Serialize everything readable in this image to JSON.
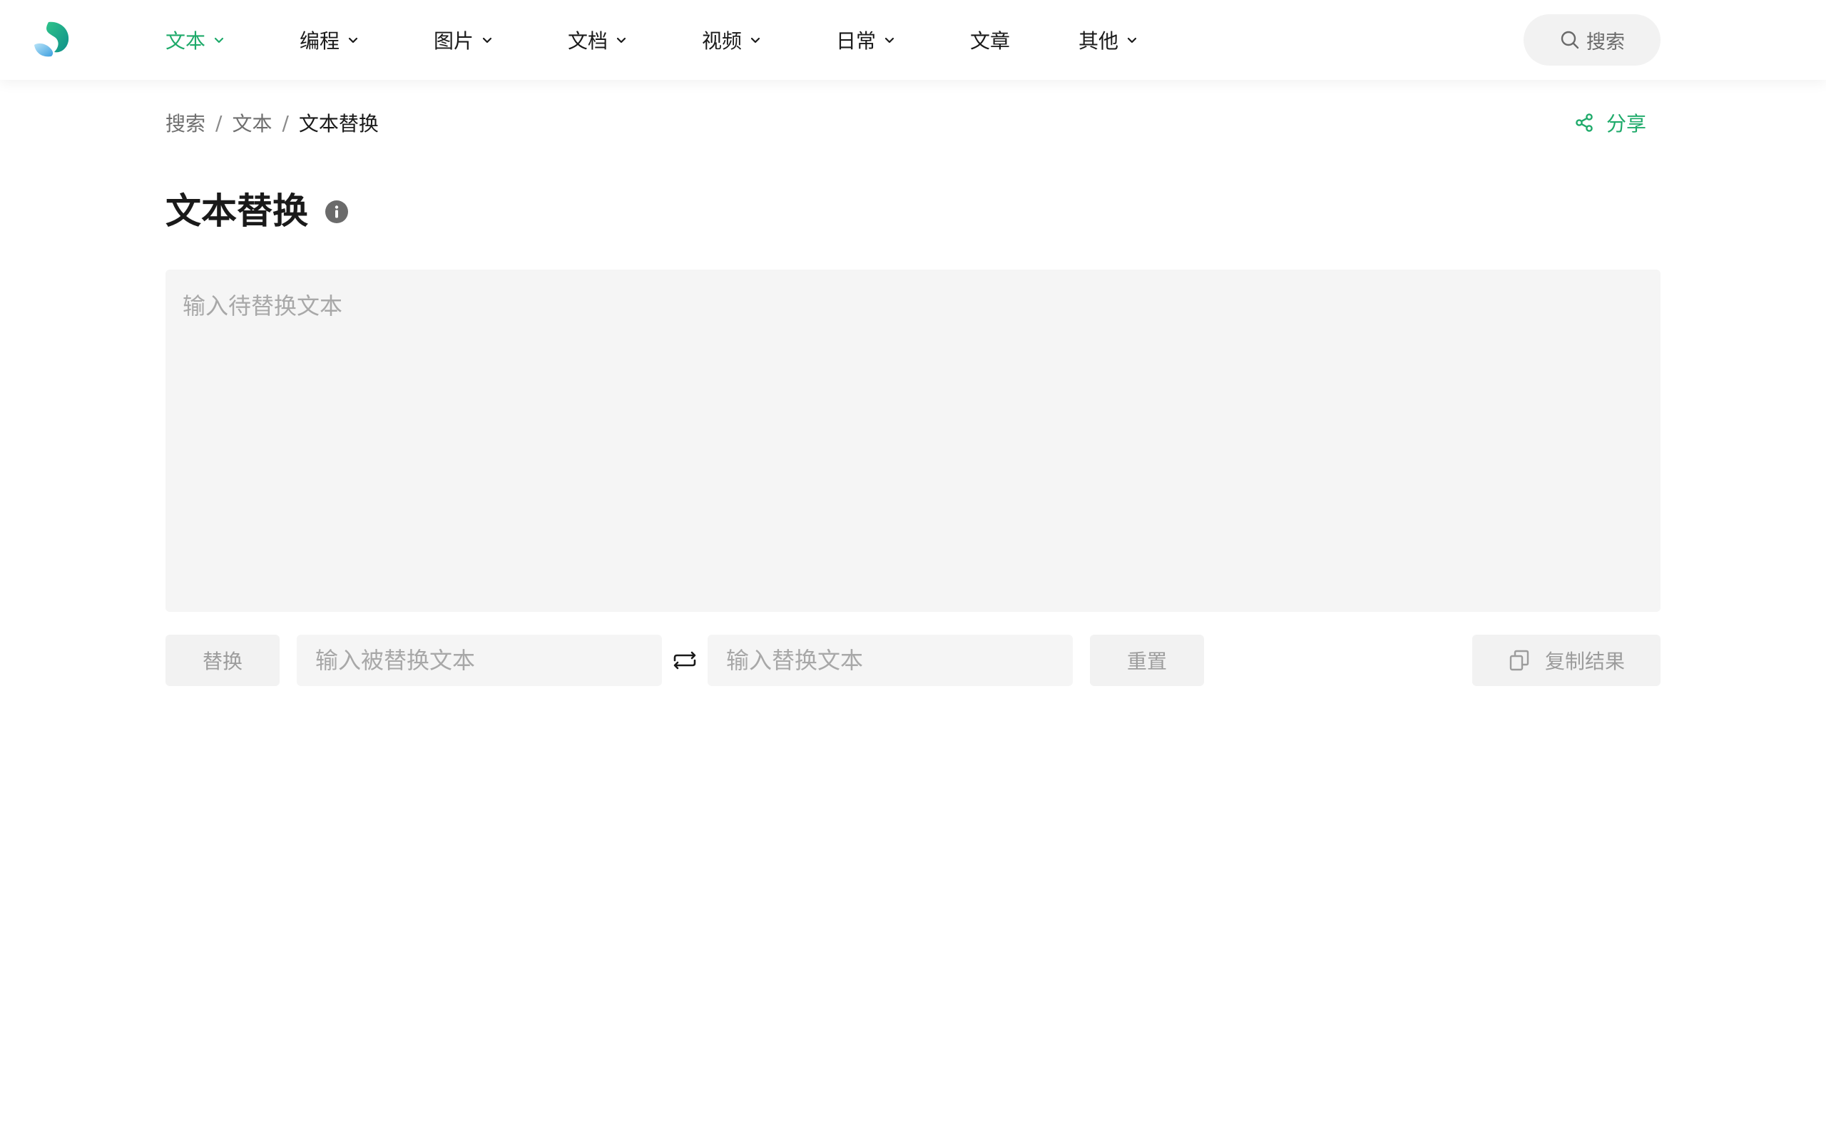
{
  "nav": {
    "items": [
      {
        "label": "文本",
        "icon": "chevron-down-icon",
        "active": true
      },
      {
        "label": "编程",
        "icon": "chevron-down-icon"
      },
      {
        "label": "图片",
        "icon": "chevron-down-icon"
      },
      {
        "label": "文档",
        "icon": "chevron-down-icon"
      },
      {
        "label": "视频",
        "icon": "chevron-down-icon"
      },
      {
        "label": "日常",
        "icon": "chevron-down-icon"
      },
      {
        "label": "文章"
      },
      {
        "label": "其他",
        "icon": "chevron-down-icon"
      }
    ],
    "search_label": "搜索",
    "accent_color": "#1eaa6a"
  },
  "breadcrumb": {
    "items": [
      "搜索",
      "文本",
      "文本替换"
    ],
    "separator": "/"
  },
  "share_label": "分享",
  "page": {
    "title": "文本替换"
  },
  "editor": {
    "source_placeholder": "输入待替换文本",
    "replace_button": "替换",
    "find_placeholder": "输入被替换文本",
    "replacement_placeholder": "输入替换文本",
    "reset_button": "重置",
    "copy_button": "复制结果"
  }
}
